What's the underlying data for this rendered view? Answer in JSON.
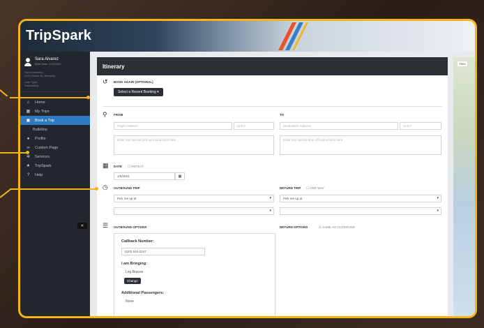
{
  "app": {
    "logo": "TripSpark"
  },
  "user": {
    "name": "Sara Alvarez",
    "dob": "Birth Date: 1/15/1951",
    "home_label": "Home Address:",
    "home_value": "2070 Olveln St, Berkeley",
    "type_label": "User Type:",
    "type_value": "Ambulatory"
  },
  "nav": {
    "items": [
      {
        "label": "Home",
        "icon": "home-icon"
      },
      {
        "label": "My Trips",
        "icon": "calendar-icon"
      },
      {
        "label": "Book a Trip",
        "icon": "bus-icon",
        "active": true
      },
      {
        "label": "Bulletins",
        "icon": "",
        "sub": true
      },
      {
        "label": "Profile",
        "icon": "person-icon"
      },
      {
        "label": "Custom Page",
        "icon": "link-icon"
      },
      {
        "label": "Services",
        "icon": "gear-icon"
      },
      {
        "label": "TripSpark",
        "icon": "star-icon"
      },
      {
        "label": "Help",
        "icon": "help-icon"
      }
    ],
    "collapse": "«"
  },
  "itinerary": {
    "title": "Itinerary",
    "book_again_label": "BOOK AGAIN (OPTIONAL)",
    "recent_booking_button": "Select a Recent Booking ▾",
    "from_label": "FROM",
    "to_label": "TO",
    "origin_placeholder": "Origin Address",
    "origin_unit_placeholder": "Unit #",
    "dest_placeholder": "Destination Address",
    "dest_unit_placeholder": "Unit #",
    "pickup_instructions_placeholder": "Enter any special pick up instructions here",
    "dropoff_instructions_placeholder": "Enter any special drop off instructions here",
    "date_label": "DATE",
    "repeat_label": "REPEAT",
    "date_value": "1/8/2016",
    "outbound_trip_label": "OUTBOUND TRIP",
    "return_trip_label": "RETURN TRIP",
    "one_way_label": "ONE WAY",
    "outbound_select": "Pick me up at",
    "return_select": "Pick me up at",
    "outbound_options_label": "OUTBOUND OPTIONS",
    "return_options_label": "RETURN OPTIONS",
    "same_as_outbound_label": "SAME AS OUTBOUND",
    "callback_label": "Callback Number:",
    "callback_value": "(520) 544-2247",
    "bringing_label": "I am Bringing:",
    "bringing_value": "Leg Braces",
    "change_button": "Change",
    "passengers_label": "Additional Passengers:",
    "passengers_value": "None"
  },
  "map": {
    "tag": "TRIO"
  }
}
